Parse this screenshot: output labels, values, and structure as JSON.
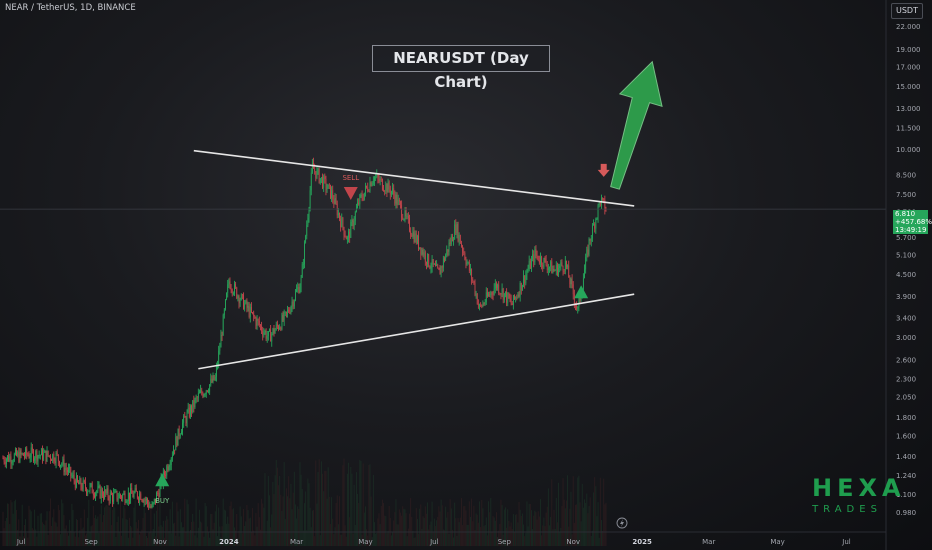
{
  "header": {
    "symbol_line": "NEAR / TetherUS, 1D, BINANCE"
  },
  "title": "NEARUSDT (Day Chart)",
  "currency_label": "USDT",
  "price_tag": {
    "price": "6.810",
    "change": "+457.68%",
    "countdown": "13:49:19"
  },
  "signals": {
    "buy_label": "BUY",
    "sell_label": "SELL"
  },
  "logo": {
    "top": "HEXA",
    "bottom": "TRADES"
  },
  "icons": {
    "replay": "lightning-icon"
  },
  "colors": {
    "up": "#26a65b",
    "down": "#c2454b",
    "arrow": "#2fa84f",
    "sell_marker": "#d65a5a",
    "trendline": "#e6e6e6"
  },
  "chart_data": {
    "type": "candlestick",
    "timeframe": "1D",
    "scale": "log",
    "ylim": [
      0.93,
      22.0
    ],
    "y_ticks": [
      "22.000",
      "19.000",
      "17.000",
      "15.000",
      "13.000",
      "11.500",
      "10.000",
      "8.500",
      "7.500",
      "6.700",
      "5.700",
      "5.100",
      "4.500",
      "3.900",
      "3.400",
      "3.000",
      "2.600",
      "2.300",
      "2.050",
      "1.800",
      "1.600",
      "1.400",
      "1.240",
      "1.100",
      "0.980"
    ],
    "x_ticks": [
      "Jul",
      "Sep",
      "Nov",
      "2024",
      "Mar",
      "May",
      "Jul",
      "Sep",
      "Nov",
      "2025",
      "Mar",
      "May",
      "Jul"
    ],
    "price_path": [
      {
        "date": "2023-06-15",
        "price": 1.38
      },
      {
        "date": "2023-07-10",
        "price": 1.42
      },
      {
        "date": "2023-08-01",
        "price": 1.4
      },
      {
        "date": "2023-08-20",
        "price": 1.17
      },
      {
        "date": "2023-09-20",
        "price": 1.08
      },
      {
        "date": "2023-10-15",
        "price": 1.1
      },
      {
        "date": "2023-10-25",
        "price": 1.0
      },
      {
        "date": "2023-11-01",
        "price": 1.15
      },
      {
        "date": "2023-11-20",
        "price": 1.7
      },
      {
        "date": "2023-12-05",
        "price": 2.05
      },
      {
        "date": "2023-12-20",
        "price": 2.3
      },
      {
        "date": "2024-01-01",
        "price": 4.3
      },
      {
        "date": "2024-01-20",
        "price": 3.5
      },
      {
        "date": "2024-02-05",
        "price": 3.0
      },
      {
        "date": "2024-02-20",
        "price": 3.4
      },
      {
        "date": "2024-03-05",
        "price": 4.3
      },
      {
        "date": "2024-03-15",
        "price": 8.9
      },
      {
        "date": "2024-04-01",
        "price": 7.5
      },
      {
        "date": "2024-04-15",
        "price": 5.6
      },
      {
        "date": "2024-04-25",
        "price": 7.1
      },
      {
        "date": "2024-05-08",
        "price": 8.4
      },
      {
        "date": "2024-05-25",
        "price": 7.6
      },
      {
        "date": "2024-06-10",
        "price": 6.0
      },
      {
        "date": "2024-06-25",
        "price": 4.9
      },
      {
        "date": "2024-07-05",
        "price": 4.5
      },
      {
        "date": "2024-07-20",
        "price": 6.1
      },
      {
        "date": "2024-08-05",
        "price": 4.2
      },
      {
        "date": "2024-08-10",
        "price": 3.6
      },
      {
        "date": "2024-08-25",
        "price": 4.2
      },
      {
        "date": "2024-09-08",
        "price": 3.7
      },
      {
        "date": "2024-09-28",
        "price": 5.1
      },
      {
        "date": "2024-10-15",
        "price": 4.6
      },
      {
        "date": "2024-10-25",
        "price": 4.8
      },
      {
        "date": "2024-11-05",
        "price": 3.55
      },
      {
        "date": "2024-11-15",
        "price": 5.5
      },
      {
        "date": "2024-11-25",
        "price": 7.2
      },
      {
        "date": "2024-11-30",
        "price": 6.81
      }
    ],
    "trendlines": [
      {
        "name": "resistance",
        "from": {
          "date": "2023-12-01",
          "price": 9.9
        },
        "to": {
          "date": "2024-12-25",
          "price": 6.95
        }
      },
      {
        "name": "support",
        "from": {
          "date": "2023-12-05",
          "price": 2.45
        },
        "to": {
          "date": "2024-12-25",
          "price": 3.95
        }
      }
    ],
    "signals": [
      {
        "type": "buy",
        "date": "2023-11-03",
        "price": 1.2,
        "label": "BUY"
      },
      {
        "type": "sell",
        "date": "2024-04-18",
        "price": 7.6,
        "label": "SELL"
      },
      {
        "type": "buy",
        "date": "2024-11-08",
        "price": 4.0,
        "label": ""
      }
    ],
    "projection": {
      "from": {
        "date": "2024-12-08",
        "price": 7.8
      },
      "to": {
        "date": "2025-01-10",
        "price": 17.5
      }
    },
    "grid": false
  }
}
